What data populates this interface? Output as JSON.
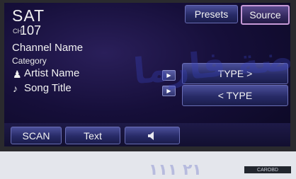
{
  "display": {
    "source_name": "SAT",
    "channel_prefix": "CH",
    "channel_number": "107",
    "channel_name": "Channel Name",
    "category": "Category",
    "artist_icon": "♟",
    "artist_name": "Artist Name",
    "song_icon": "♪",
    "song_title": "Song Title"
  },
  "top_buttons": {
    "presets_label": "Presets",
    "source_label": "Source"
  },
  "type_buttons": {
    "next_label": "TYPE >",
    "prev_label": "< TYPE"
  },
  "play_icon": "▶",
  "bottom_buttons": {
    "scan_label": "SCAN",
    "text_label": "Text"
  },
  "watermark": {
    "main": "روضة فارما",
    "lower": "٢١ ١١١"
  },
  "corner_badge": "CAROBD"
}
